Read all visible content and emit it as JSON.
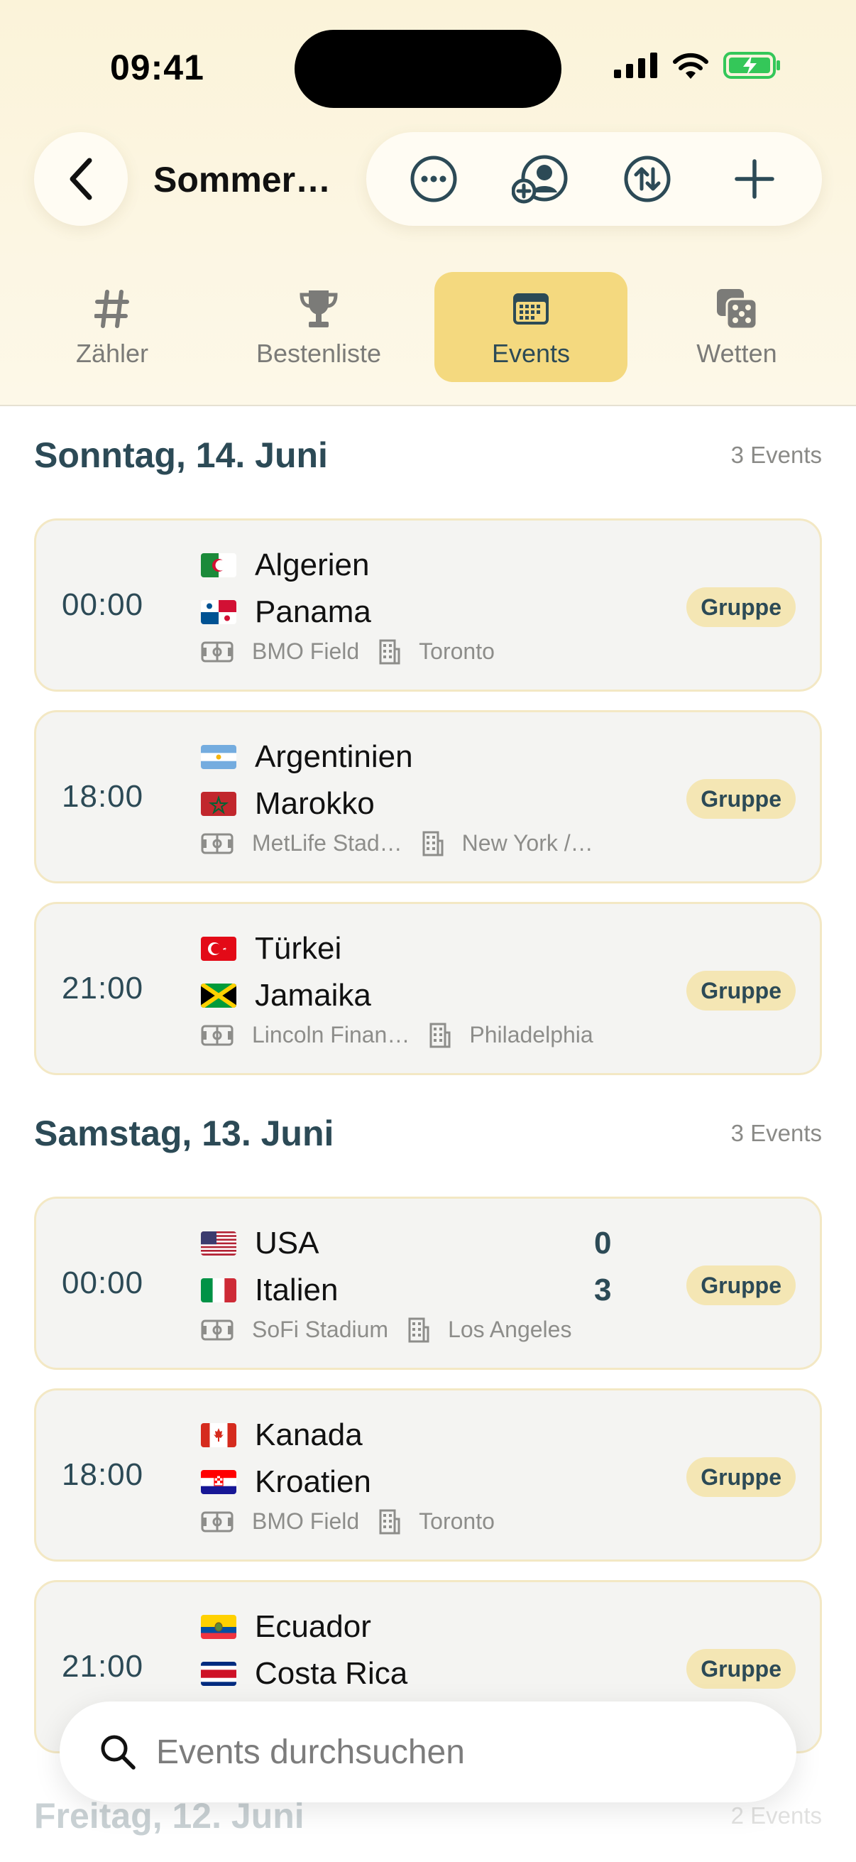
{
  "status": {
    "time": "09:41"
  },
  "header": {
    "title": "Sommer…"
  },
  "tabs": [
    {
      "label": "Zähler",
      "icon": "hash-icon",
      "active": false
    },
    {
      "label": "Bestenliste",
      "icon": "trophy-icon",
      "active": false
    },
    {
      "label": "Events",
      "icon": "calendar-icon",
      "active": true
    },
    {
      "label": "Wetten",
      "icon": "dice-icon",
      "active": false
    }
  ],
  "sections": [
    {
      "title": "Sonntag, 14. Juni",
      "count": "3 Events",
      "events": [
        {
          "time": "00:00",
          "home": "Algerien",
          "away": "Panama",
          "venue": "BMO Field",
          "city": "Toronto",
          "badge": "Gruppe"
        },
        {
          "time": "18:00",
          "home": "Argentinien",
          "away": "Marokko",
          "venue": "MetLife Stad…",
          "city": "New York /…",
          "badge": "Gruppe"
        },
        {
          "time": "21:00",
          "home": "Türkei",
          "away": "Jamaika",
          "venue": "Lincoln Finan…",
          "city": "Philadelphia",
          "badge": "Gruppe"
        }
      ]
    },
    {
      "title": "Samstag, 13. Juni",
      "count": "3 Events",
      "events": [
        {
          "time": "00:00",
          "home": "USA",
          "away": "Italien",
          "home_score": "0",
          "away_score": "3",
          "venue": "SoFi Stadium",
          "city": "Los Angeles",
          "badge": "Gruppe"
        },
        {
          "time": "18:00",
          "home": "Kanada",
          "away": "Kroatien",
          "venue": "BMO Field",
          "city": "Toronto",
          "badge": "Gruppe"
        },
        {
          "time": "21:00",
          "home": "Ecuador",
          "away": "Costa Rica",
          "badge": "Gruppe"
        }
      ]
    },
    {
      "title": "Freitag, 12. Juni",
      "count": "2 Events"
    }
  ],
  "search": {
    "placeholder": "Events durchsuchen"
  },
  "colors": {
    "accent": "#f4d97f",
    "text_primary": "#2c4a56",
    "badge_bg": "#f4e6b4",
    "header_bg": "#fcf6e3"
  }
}
